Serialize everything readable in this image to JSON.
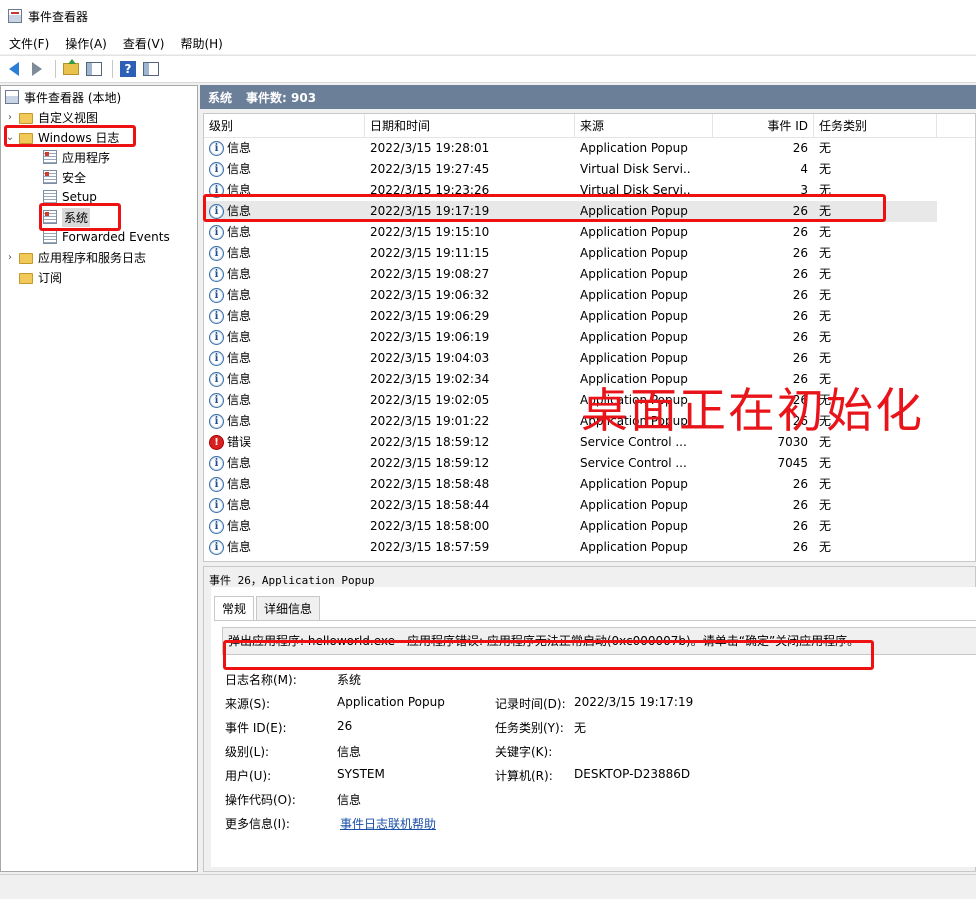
{
  "window": {
    "title": "事件查看器",
    "icon": "event-viewer-icon"
  },
  "menu": [
    "文件(F)",
    "操作(A)",
    "查看(V)",
    "帮助(H)"
  ],
  "toolbar": {
    "buttons": [
      "back-arrow-icon",
      "forward-arrow-icon",
      "up-folder-icon",
      "show-pane-icon",
      "help-icon",
      "action-pane-icon"
    ],
    "help_glyph": "?"
  },
  "tree": {
    "root": "事件查看器 (本地)",
    "custom_views": "自定义视图",
    "windows_logs": "Windows 日志",
    "logs": [
      "应用程序",
      "安全",
      "Setup",
      "系统",
      "Forwarded Events"
    ],
    "app_service_logs": "应用程序和服务日志",
    "subscriptions": "订阅",
    "selected": "系统"
  },
  "log_header": {
    "name": "系统",
    "count_label": "事件数: 903"
  },
  "columns": [
    "级别",
    "日期和时间",
    "来源",
    "事件 ID",
    "任务类别"
  ],
  "events": [
    {
      "level": "信息",
      "type": "info",
      "datetime": "2022/3/15 19:28:01",
      "source": "Application Popup",
      "id": "26",
      "task": "无"
    },
    {
      "level": "信息",
      "type": "info",
      "datetime": "2022/3/15 19:27:45",
      "source": "Virtual Disk Servi...",
      "id": "4",
      "task": "无"
    },
    {
      "level": "信息",
      "type": "info",
      "datetime": "2022/3/15 19:23:26",
      "source": "Virtual Disk Servi...",
      "id": "3",
      "task": "无"
    },
    {
      "level": "信息",
      "type": "info",
      "datetime": "2022/3/15 19:17:19",
      "source": "Application Popup",
      "id": "26",
      "task": "无"
    },
    {
      "level": "信息",
      "type": "info",
      "datetime": "2022/3/15 19:15:10",
      "source": "Application Popup",
      "id": "26",
      "task": "无"
    },
    {
      "level": "信息",
      "type": "info",
      "datetime": "2022/3/15 19:11:15",
      "source": "Application Popup",
      "id": "26",
      "task": "无"
    },
    {
      "level": "信息",
      "type": "info",
      "datetime": "2022/3/15 19:08:27",
      "source": "Application Popup",
      "id": "26",
      "task": "无"
    },
    {
      "level": "信息",
      "type": "info",
      "datetime": "2022/3/15 19:06:32",
      "source": "Application Popup",
      "id": "26",
      "task": "无"
    },
    {
      "level": "信息",
      "type": "info",
      "datetime": "2022/3/15 19:06:29",
      "source": "Application Popup",
      "id": "26",
      "task": "无"
    },
    {
      "level": "信息",
      "type": "info",
      "datetime": "2022/3/15 19:06:19",
      "source": "Application Popup",
      "id": "26",
      "task": "无"
    },
    {
      "level": "信息",
      "type": "info",
      "datetime": "2022/3/15 19:04:03",
      "source": "Application Popup",
      "id": "26",
      "task": "无"
    },
    {
      "level": "信息",
      "type": "info",
      "datetime": "2022/3/15 19:02:34",
      "source": "Application Popup",
      "id": "26",
      "task": "无"
    },
    {
      "level": "信息",
      "type": "info",
      "datetime": "2022/3/15 19:02:05",
      "source": "Application Popup",
      "id": "26",
      "task": "无"
    },
    {
      "level": "信息",
      "type": "info",
      "datetime": "2022/3/15 19:01:22",
      "source": "Application Popup",
      "id": "26",
      "task": "无"
    },
    {
      "level": "错误",
      "type": "error",
      "datetime": "2022/3/15 18:59:12",
      "source": "Service Control ...",
      "id": "7030",
      "task": "无"
    },
    {
      "level": "信息",
      "type": "info",
      "datetime": "2022/3/15 18:59:12",
      "source": "Service Control ...",
      "id": "7045",
      "task": "无"
    },
    {
      "level": "信息",
      "type": "info",
      "datetime": "2022/3/15 18:58:48",
      "source": "Application Popup",
      "id": "26",
      "task": "无"
    },
    {
      "level": "信息",
      "type": "info",
      "datetime": "2022/3/15 18:58:44",
      "source": "Application Popup",
      "id": "26",
      "task": "无"
    },
    {
      "level": "信息",
      "type": "info",
      "datetime": "2022/3/15 18:58:00",
      "source": "Application Popup",
      "id": "26",
      "task": "无"
    },
    {
      "level": "信息",
      "type": "info",
      "datetime": "2022/3/15 18:57:59",
      "source": "Application Popup",
      "id": "26",
      "task": "无"
    }
  ],
  "selected_event_index": 3,
  "detail": {
    "title": "事件 26，Application Popup",
    "tabs": [
      "常规",
      "详细信息"
    ],
    "message": "弹出应用程序: helloworld.exe - 应用程序错误: 应用程序无法正常启动(0xc000007b)。请单击“确定”关闭应用程序。",
    "labels": {
      "log_name": "日志名称(M):",
      "source": "来源(S):",
      "event_id": "事件 ID(E):",
      "level": "级别(L):",
      "user": "用户(U):",
      "opcode": "操作代码(O):",
      "more_info": "更多信息(I):",
      "logged": "记录时间(D):",
      "task_category": "任务类别(Y):",
      "keywords": "关键字(K):",
      "computer": "计算机(R):"
    },
    "values": {
      "log_name": "系统",
      "source": "Application Popup",
      "event_id": "26",
      "level": "信息",
      "user": "SYSTEM",
      "opcode": "信息",
      "more_info_link": "事件日志联机帮助",
      "logged": "2022/3/15 19:17:19",
      "task_category": "无",
      "keywords": "",
      "computer": "DESKTOP-D23886D"
    }
  },
  "overlay": {
    "watermark_text": "桌面正在初始化",
    "annotation_color": "#e11111"
  },
  "colors": {
    "header_strip": "#6b7f99",
    "link": "#1a4fa8",
    "error": "#d92020",
    "info": "#3a6ea5"
  }
}
